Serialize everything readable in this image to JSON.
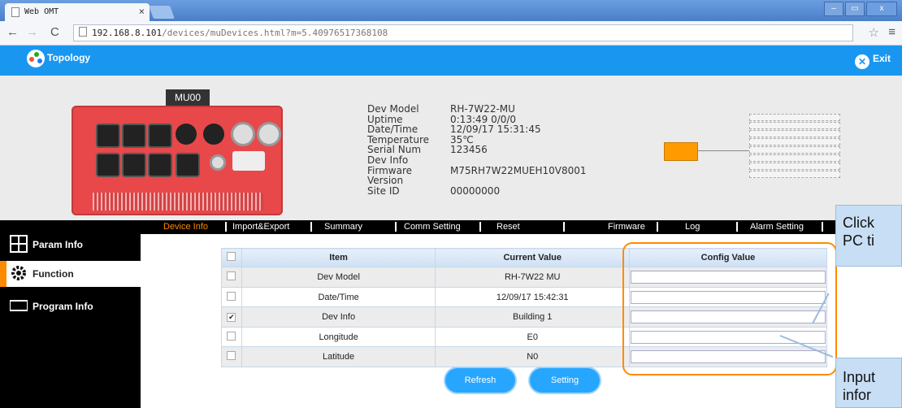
{
  "browser": {
    "tab_title": "Web OMT",
    "tab_close": "×",
    "url_host": "192.168.8.101",
    "url_path": "/devices/muDevices.html?m=5.40976517368108",
    "window_buttons": [
      "–",
      "▭",
      "x"
    ]
  },
  "header": {
    "title": "Topology",
    "exit_label": "Exit"
  },
  "device": {
    "label": "MU00",
    "info": [
      {
        "key": "Dev Model",
        "value": "RH-7W22-MU"
      },
      {
        "key": "Uptime",
        "value": "0:13:49 0/0/0"
      },
      {
        "key": "Date/Time",
        "value": "12/09/17 15:31:45"
      },
      {
        "key": "Temperature",
        "value": "35℃"
      },
      {
        "key": "Serial Num",
        "value": "123456"
      },
      {
        "key": "Dev Info",
        "value": ""
      },
      {
        "key": "Firmware Version",
        "value": "M75RH7W22MUEH10V8001"
      },
      {
        "key": "Site ID",
        "value": "00000000"
      }
    ]
  },
  "sidebar": {
    "items": [
      {
        "label": "Param Info"
      },
      {
        "label": "Function"
      },
      {
        "label": "Program Info"
      }
    ],
    "active": "Function"
  },
  "tabs": {
    "items": [
      "Device Info",
      "Import&Export",
      "Summary",
      "Comm Setting",
      "Reset",
      "Firmware",
      "Log",
      "Alarm Setting"
    ],
    "active": "Device Info"
  },
  "table": {
    "headers": [
      "Item",
      "Current Value",
      "Config Value"
    ],
    "rows": [
      {
        "item": "Dev Model",
        "current": "RH-7W22 MU",
        "config": "",
        "checked": false
      },
      {
        "item": "Date/Time",
        "current": "12/09/17 15:42:31",
        "config": "",
        "checked": false
      },
      {
        "item": "Dev Info",
        "current": "Building 1",
        "config": "",
        "checked": true
      },
      {
        "item": "Longitude",
        "current": "E0",
        "config": "",
        "checked": false
      },
      {
        "item": "Latitude",
        "current": "N0",
        "config": "",
        "checked": false
      }
    ]
  },
  "buttons": {
    "refresh": "Refresh",
    "setting": "Setting"
  },
  "callouts": {
    "top": "Click\nPC ti",
    "bottom": "Input\ninfor"
  },
  "colors": {
    "header_blue": "#1997f0",
    "accent_orange": "#ff8a00",
    "sidebar_bg": "#000000"
  }
}
